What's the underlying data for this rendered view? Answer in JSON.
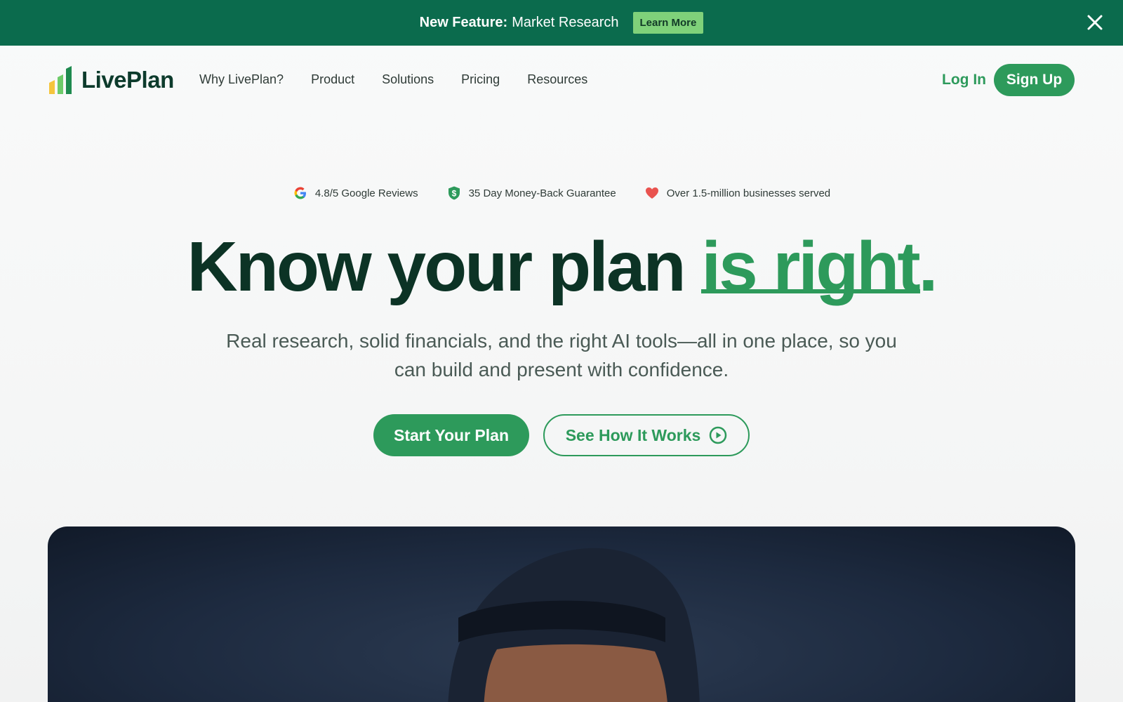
{
  "announcement": {
    "label_strong": "New Feature:",
    "label": "Market Research",
    "button": "Learn More"
  },
  "header": {
    "brand": "LivePlan",
    "nav": [
      "Why LivePlan?",
      "Product",
      "Solutions",
      "Pricing",
      "Resources"
    ],
    "login": "Log In",
    "signup": "Sign Up"
  },
  "trust": {
    "reviews": "4.8/5 Google Reviews",
    "guarantee": "35 Day Money-Back Guarantee",
    "served": "Over 1.5-million businesses served"
  },
  "hero": {
    "title_main": "Know your plan",
    "title_accent": "is right.",
    "subtitle": "Real research, solid financials, and the right AI tools—all in one place, so you can build and present with confidence.",
    "primary_cta": "Start Your Plan",
    "secondary_cta": "See How It Works"
  },
  "colors": {
    "brand_green": "#2d9a5b",
    "banner_green": "#0b6b4d",
    "dark_text": "#0c3325"
  },
  "icons": {
    "close": "close-icon",
    "reviews": "google-icon",
    "guarantee": "shield-dollar-icon",
    "served": "heart-icon",
    "play": "play-circle-icon"
  }
}
